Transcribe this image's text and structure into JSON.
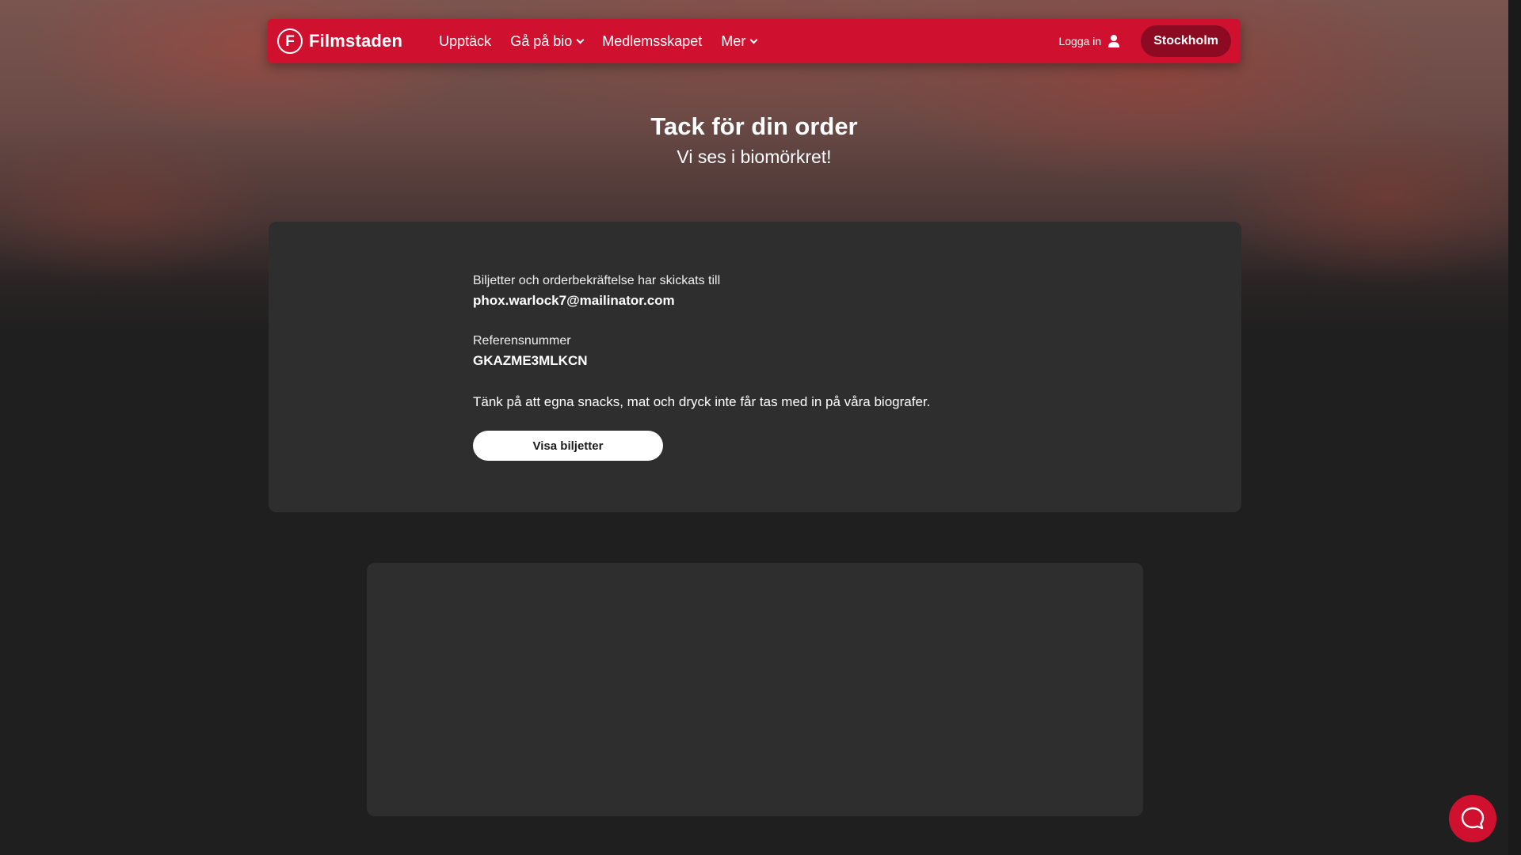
{
  "brand": {
    "logo_letter": "F",
    "name": "Filmstaden"
  },
  "nav": {
    "items": [
      {
        "label": "Upptäck",
        "has_dropdown": false
      },
      {
        "label": "Gå på bio",
        "has_dropdown": true
      },
      {
        "label": "Medlemsskapet",
        "has_dropdown": false
      },
      {
        "label": "Mer",
        "has_dropdown": true
      }
    ],
    "login_label": "Logga in",
    "login_icon": "user-icon",
    "city_label": "Stockholm"
  },
  "hero": {
    "title": "Tack för din order",
    "subtitle": "Vi ses i biomörkret!"
  },
  "order": {
    "sent_to_label": "Biljetter och orderbekräftelse har skickats till",
    "email": "phox.warlock7@mailinator.com",
    "reference_label": "Referensnummer",
    "reference_number": "GKAZME3MLKCN",
    "notice": "Tänk på att egna snacks, mat och dryck inte får tas med in på våra biografer.",
    "show_tickets_label": "Visa biljetter"
  },
  "chat": {
    "icon": "chat-bubble-icon"
  },
  "colors": {
    "brand_red": "#d0102f",
    "city_button": "#8c0b22",
    "card_background": "#2e2e2e",
    "page_background": "#1f1f1f"
  }
}
